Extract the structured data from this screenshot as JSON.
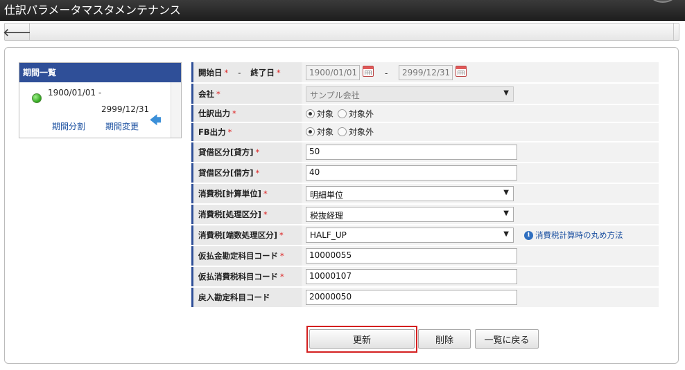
{
  "window": {
    "title": "仕訳パラメータマスタメンテナンス"
  },
  "toolbar": {
    "back_icon": "arrow-left-icon",
    "back_symbol": "🡐"
  },
  "period_list": {
    "header": "期間一覧",
    "start": "1900/01/01  -",
    "end": "2999/12/31",
    "split_link": "期間分割",
    "change_link": "期間変更",
    "arrow_symbol": "🡄"
  },
  "form": {
    "period": {
      "start_label": "開始日",
      "dash": "-",
      "end_label": "終了日",
      "start_value": "1900/01/01",
      "range_dash": "-",
      "end_value": "2999/12/31"
    },
    "company": {
      "label": "会社",
      "value": "サンプル会社"
    },
    "journal_output": {
      "label": "仕訳出力",
      "options": [
        "対象",
        "対象外"
      ],
      "selected": 0
    },
    "fb_output": {
      "label": "FB出力",
      "options": [
        "対象",
        "対象外"
      ],
      "selected": 0
    },
    "credit_debit_credit": {
      "label": "貸借区分[貸方]",
      "value": "50"
    },
    "credit_debit_debit": {
      "label": "貸借区分[借方]",
      "value": "40"
    },
    "tax_calc_unit": {
      "label": "消費税[計算単位]",
      "value": "明細単位"
    },
    "tax_process": {
      "label": "消費税[処理区分]",
      "value": "税抜経理"
    },
    "tax_rounding": {
      "label": "消費税[端数処理区分]",
      "value": "HALF_UP",
      "help_link": "消費税計算時の丸め方法"
    },
    "prepaid_account": {
      "label": "仮払金勘定科目コード",
      "value": "10000055"
    },
    "prepaid_tax_account": {
      "label": "仮払消費税科目コード",
      "value": "10000107"
    },
    "refund_account": {
      "label": "戻入勘定科目コード",
      "value": "20000050"
    },
    "required_mark": "*"
  },
  "buttons": {
    "update": "更新",
    "delete": "削除",
    "back_to_list": "一覧に戻る"
  },
  "colors": {
    "accent": "#2f4f98",
    "required": "#d22222",
    "highlight": "#d41f1f"
  }
}
